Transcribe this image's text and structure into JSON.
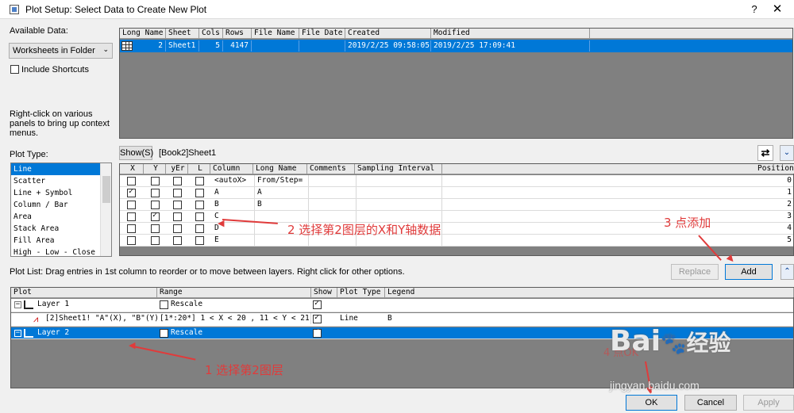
{
  "window": {
    "title": "Plot Setup: Select Data to Create New Plot",
    "help": "?",
    "close": "✕"
  },
  "left": {
    "available_label": "Available Data:",
    "source_selected": "Worksheets in Folder",
    "include_shortcuts": "Include Shortcuts",
    "hint": "Right-click on various panels to bring up context menus.",
    "plot_type_label": "Plot Type:",
    "plot_types": [
      "Line",
      "Scatter",
      "Line + Symbol",
      "Column / Bar",
      "Area",
      "Stack Area",
      "Fill Area",
      "High - Low - Close"
    ],
    "plot_type_selected": 0
  },
  "sheets_table": {
    "headers": [
      "Long Name",
      "Sheet",
      "Cols",
      "Rows",
      "File Name",
      "File Date",
      "Created",
      "Modified"
    ],
    "row": {
      "long_name": "2",
      "sheet": "Sheet1",
      "cols": "5",
      "rows": "4147",
      "file_name": "",
      "file_date": "",
      "created": "2019/2/25 09:58:05",
      "modified": "2019/2/25 17:09:41"
    }
  },
  "columns_panel": {
    "show_button": "Show(S)",
    "book_label": "[Book2]Sheet1",
    "headers": [
      "X",
      "Y",
      "yEr",
      "L",
      "Column",
      "Long Name",
      "Comments",
      "Sampling Interval",
      "Position"
    ],
    "rows": [
      {
        "x": false,
        "y": false,
        "yer": false,
        "l": false,
        "column": "<autoX>",
        "long_name": "From/Step=",
        "comments": "",
        "position": "0"
      },
      {
        "x": true,
        "y": false,
        "yer": false,
        "l": false,
        "column": "A",
        "long_name": "A",
        "comments": "",
        "position": "1"
      },
      {
        "x": false,
        "y": false,
        "yer": false,
        "l": false,
        "column": "B",
        "long_name": "B",
        "comments": "",
        "position": "2"
      },
      {
        "x": false,
        "y": true,
        "yer": false,
        "l": false,
        "column": "C",
        "long_name": "",
        "comments": "",
        "position": "3"
      },
      {
        "x": false,
        "y": false,
        "yer": false,
        "l": false,
        "column": "D",
        "long_name": "",
        "comments": "",
        "position": "4"
      },
      {
        "x": false,
        "y": false,
        "yer": false,
        "l": false,
        "column": "E",
        "long_name": "",
        "comments": "",
        "position": "5"
      }
    ]
  },
  "plot_list": {
    "label": "Plot List: Drag entries in 1st column to reorder or to move between layers. Right click for other options.",
    "replace": "Replace",
    "add": "Add",
    "headers": [
      "Plot",
      "Range",
      "Show",
      "Plot Type",
      "Legend"
    ],
    "rows": [
      {
        "plot": "Layer 1",
        "range": "Rescale",
        "show": true,
        "plot_type": "",
        "legend": ""
      },
      {
        "plot": "[2]Sheet1! \"A\"(X), \"B\"(Y)",
        "range": "[1*:20*]  1 < X < 20 , 11 < Y < 21",
        "show": true,
        "plot_type": "Line",
        "legend": "B"
      },
      {
        "plot": "Layer 2",
        "range": "Rescale",
        "show": true,
        "plot_type": "",
        "legend": ""
      }
    ]
  },
  "buttons": {
    "ok": "OK",
    "cancel": "Cancel",
    "apply": "Apply"
  },
  "annotations": {
    "step1": "1 选择第2图层",
    "step2": "2 选择第2图层的X和Y轴数据",
    "step3": "3 点添加",
    "step4": "4 点OK",
    "color": "#e03b3b"
  },
  "watermark": {
    "brand": "Bai",
    "brand2": "经验",
    "url": "jingyan.baidu.com"
  }
}
